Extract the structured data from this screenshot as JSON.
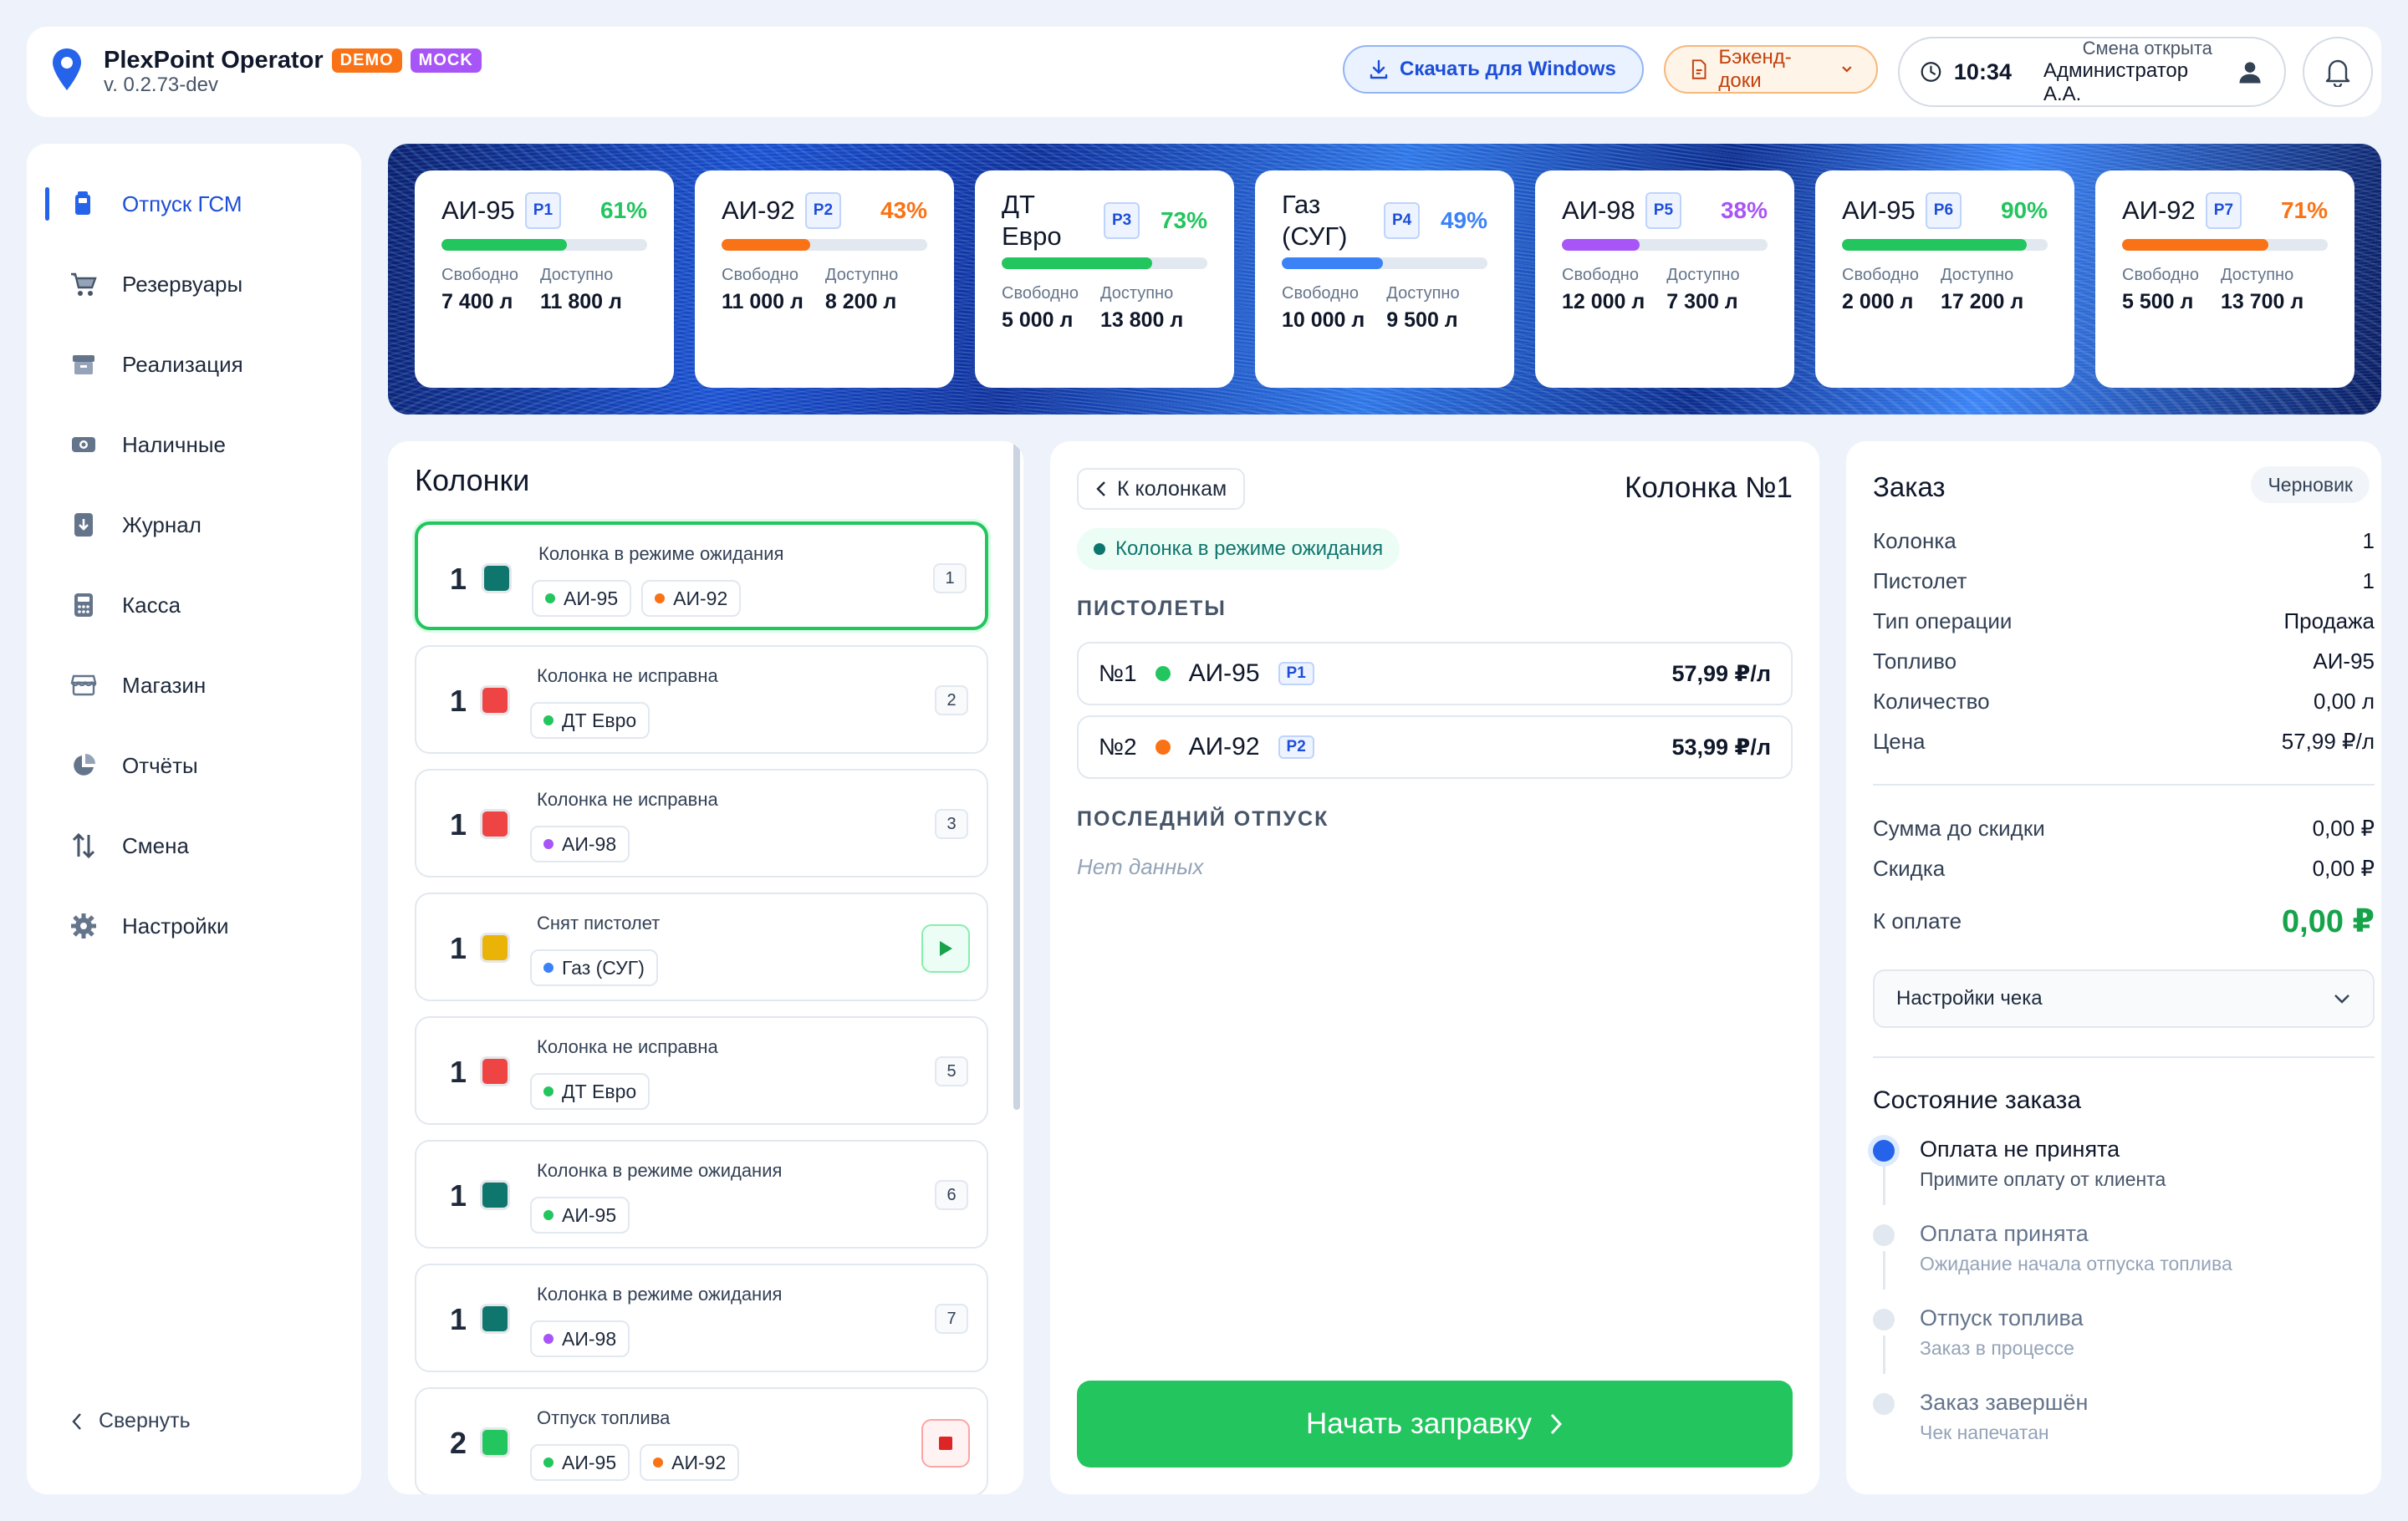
{
  "header": {
    "app_name": "PlexPoint Operator",
    "badge_demo": "DEMO",
    "badge_mock": "MOCK",
    "version": "v. 0.2.73-dev",
    "download_label": "Скачать для Windows",
    "backend_docs_label": "Бэкенд-доки",
    "time": "10:34",
    "shift_status": "Смена открыта",
    "operator": "Администратор А.А.",
    "colors": {
      "demo": "#f97316",
      "mock": "#a855f7",
      "accent": "#2563eb"
    }
  },
  "sidebar": {
    "items": [
      {
        "label": "Отпуск ГСМ",
        "icon": "fuel-pump-icon"
      },
      {
        "label": "Резервуары",
        "icon": "cart-icon"
      },
      {
        "label": "Реализация",
        "icon": "box-icon"
      },
      {
        "label": "Наличные",
        "icon": "cash-icon"
      },
      {
        "label": "Журнал",
        "icon": "journal-icon"
      },
      {
        "label": "Касса",
        "icon": "calculator-icon"
      },
      {
        "label": "Магазин",
        "icon": "store-icon"
      },
      {
        "label": "Отчёты",
        "icon": "pie-chart-icon"
      },
      {
        "label": "Смена",
        "icon": "swap-icon"
      },
      {
        "label": "Настройки",
        "icon": "gear-icon"
      }
    ],
    "collapse_label": "Свернуть"
  },
  "tanks": [
    {
      "name": "АИ-95",
      "chip": "P1",
      "percent": "61%",
      "fill": 0.61,
      "color": "#22c55e",
      "free_label": "Свободно",
      "free": "7 400 л",
      "avail_label": "Доступно",
      "avail": "11 800 л"
    },
    {
      "name": "АИ-92",
      "chip": "P2",
      "percent": "43%",
      "fill": 0.43,
      "color": "#f97316",
      "free_label": "Свободно",
      "free": "11 000 л",
      "avail_label": "Доступно",
      "avail": "8 200 л"
    },
    {
      "name": "ДТ Евро",
      "chip": "P3",
      "percent": "73%",
      "fill": 0.73,
      "color": "#22c55e",
      "free_label": "Свободно",
      "free": "5 000 л",
      "avail_label": "Доступно",
      "avail": "13 800 л"
    },
    {
      "name": "Газ (СУГ)",
      "chip": "P4",
      "percent": "49%",
      "fill": 0.49,
      "color": "#3b82f6",
      "free_label": "Свободно",
      "free": "10 000 л",
      "avail_label": "Доступно",
      "avail": "9 500 л"
    },
    {
      "name": "АИ-98",
      "chip": "P5",
      "percent": "38%",
      "fill": 0.38,
      "color": "#a855f7",
      "free_label": "Свободно",
      "free": "12 000 л",
      "avail_label": "Доступно",
      "avail": "7 300 л"
    },
    {
      "name": "АИ-95",
      "chip": "P6",
      "percent": "90%",
      "fill": 0.9,
      "color": "#22c55e",
      "free_label": "Свободно",
      "free": "2 000 л",
      "avail_label": "Доступно",
      "avail": "17 200 л"
    },
    {
      "name": "АИ-92",
      "chip": "P7",
      "percent": "71%",
      "fill": 0.71,
      "color": "#f97316",
      "free_label": "Свободно",
      "free": "5 500 л",
      "avail_label": "Доступно",
      "avail": "13 700 л"
    }
  ],
  "columns": {
    "title": "Колонки",
    "items": [
      {
        "num": "1",
        "status": "Колонка в режиме ожидания",
        "color": "#0f766e",
        "fuels": [
          {
            "name": "АИ-95",
            "color": "#22c55e"
          },
          {
            "name": "АИ-92",
            "color": "#f97316"
          }
        ],
        "index": "1",
        "action": null
      },
      {
        "num": "1",
        "status": "Колонка не исправна",
        "color": "#ef4444",
        "fuels": [
          {
            "name": "ДТ Евро",
            "color": "#22c55e"
          }
        ],
        "index": "2",
        "action": null
      },
      {
        "num": "1",
        "status": "Колонка не исправна",
        "color": "#ef4444",
        "fuels": [
          {
            "name": "АИ-98",
            "color": "#a855f7"
          }
        ],
        "index": "3",
        "action": null
      },
      {
        "num": "1",
        "status": "Снят пистолет",
        "color": "#eab308",
        "fuels": [
          {
            "name": "Газ (СУГ)",
            "color": "#3b82f6"
          }
        ],
        "index": null,
        "action": "play"
      },
      {
        "num": "1",
        "status": "Колонка не исправна",
        "color": "#ef4444",
        "fuels": [
          {
            "name": "ДТ Евро",
            "color": "#22c55e"
          }
        ],
        "index": "5",
        "action": null
      },
      {
        "num": "1",
        "status": "Колонка в режиме ожидания",
        "color": "#0f766e",
        "fuels": [
          {
            "name": "АИ-95",
            "color": "#22c55e"
          }
        ],
        "index": "6",
        "action": null
      },
      {
        "num": "1",
        "status": "Колонка в режиме ожидания",
        "color": "#0f766e",
        "fuels": [
          {
            "name": "АИ-98",
            "color": "#a855f7"
          }
        ],
        "index": "7",
        "action": null
      },
      {
        "num": "2",
        "status": "Отпуск топлива",
        "color": "#22c55e",
        "fuels": [
          {
            "name": "АИ-95",
            "color": "#22c55e"
          },
          {
            "name": "АИ-92",
            "color": "#f97316"
          }
        ],
        "index": null,
        "action": "stop"
      }
    ]
  },
  "pump": {
    "back_label": "К колонкам",
    "title": "Колонка №1",
    "status": "Колонка в режиме ожидания",
    "nozzles_heading": "ПИСТОЛЕТЫ",
    "nozzles": [
      {
        "num": "№1",
        "fuel": "АИ-95",
        "color": "#22c55e",
        "chip": "P1",
        "price": "57,99 ₽/л"
      },
      {
        "num": "№2",
        "fuel": "АИ-92",
        "color": "#f97316",
        "chip": "P2",
        "price": "53,99 ₽/л"
      }
    ],
    "last_heading": "ПОСЛЕДНИЙ ОТПУСК",
    "no_data": "Нет данных",
    "start_label": "Начать заправку"
  },
  "order": {
    "title": "Заказ",
    "status_badge": "Черновик",
    "rows": [
      {
        "label": "Колонка",
        "value": "1"
      },
      {
        "label": "Пистолет",
        "value": "1"
      },
      {
        "label": "Тип операции",
        "value": "Продажа"
      },
      {
        "label": "Топливо",
        "value": "АИ-95"
      },
      {
        "label": "Количество",
        "value": "0,00 л"
      },
      {
        "label": "Цена",
        "value": "57,99 ₽/л"
      }
    ],
    "subtotal_label": "Сумма до скидки",
    "subtotal": "0,00 ₽",
    "discount_label": "Скидка",
    "discount": "0,00 ₽",
    "total_label": "К оплате",
    "total": "0,00 ₽",
    "receipt_settings": "Настройки чека",
    "state_title": "Состояние заказа",
    "steps": [
      {
        "title": "Оплата не принята",
        "sub": "Примите оплату от клиента",
        "active": true
      },
      {
        "title": "Оплата принята",
        "sub": "Ожидание начала отпуска топлива",
        "active": false
      },
      {
        "title": "Отпуск топлива",
        "sub": "Заказ в процессе",
        "active": false
      },
      {
        "title": "Заказ завершён",
        "sub": "Чек напечатан",
        "active": false
      }
    ]
  }
}
